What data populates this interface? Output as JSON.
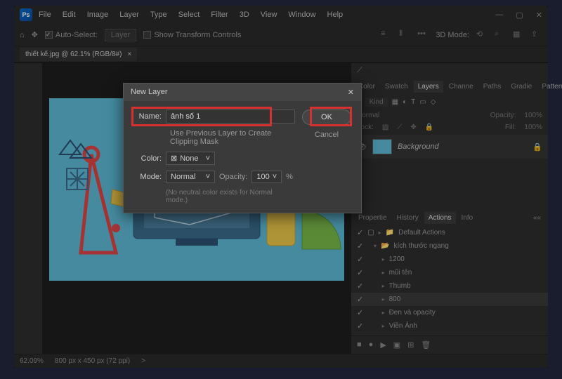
{
  "app": {
    "logo": "Ps"
  },
  "menu": [
    "File",
    "Edit",
    "Image",
    "Layer",
    "Type",
    "Select",
    "Filter",
    "3D",
    "View",
    "Window",
    "Help"
  ],
  "options": {
    "auto_select": "Auto-Select:",
    "layer": "Layer",
    "transform": "Show Transform Controls",
    "mode3d": "3D Mode:"
  },
  "tab": {
    "title": "thiết kế.jpg @ 62.1% (RGB/8#)",
    "close": "×"
  },
  "dialog": {
    "title": "New Layer",
    "name_label": "Name:",
    "name_value": "ảnh số 1",
    "clip": "Use Previous Layer to Create Clipping Mask",
    "color_label": "Color:",
    "color_value": "None",
    "mode_label": "Mode:",
    "mode_value": "Normal",
    "opacity_label": "Opacity:",
    "opacity_value": "100",
    "opacity_unit": "%",
    "hint": "(No neutral color exists for Normal mode.)",
    "ok": "OK",
    "cancel": "Cancel"
  },
  "panels": {
    "top_tabs": [
      "Color",
      "Swatch",
      "Layers",
      "Channe",
      "Paths",
      "Gradie",
      "Patterns"
    ],
    "layers": {
      "kind": "Kind",
      "blend": "Normal",
      "opacity_lbl": "Opacity:",
      "opacity": "100%",
      "lock_lbl": "Lock:",
      "fill_lbl": "Fill:",
      "fill": "100%",
      "bg": "Background"
    },
    "action_tabs": [
      "Propertie",
      "History",
      "Actions",
      "Info"
    ],
    "actions": [
      {
        "icon": "folder",
        "label": "Default Actions"
      },
      {
        "icon": "folder-open",
        "label": "kích thước ngang"
      },
      {
        "icon": "chev",
        "label": "1200"
      },
      {
        "icon": "chev",
        "label": "mũi tên"
      },
      {
        "icon": "chev",
        "label": "Thumb"
      },
      {
        "icon": "chev",
        "label": "800"
      },
      {
        "icon": "chev",
        "label": "Đen và opacity"
      },
      {
        "icon": "chev",
        "label": "Viền Ảnh"
      }
    ]
  },
  "status": {
    "zoom": "62.09%",
    "dims": "800 px x 450 px (72 ppi)",
    "chev": ">"
  }
}
